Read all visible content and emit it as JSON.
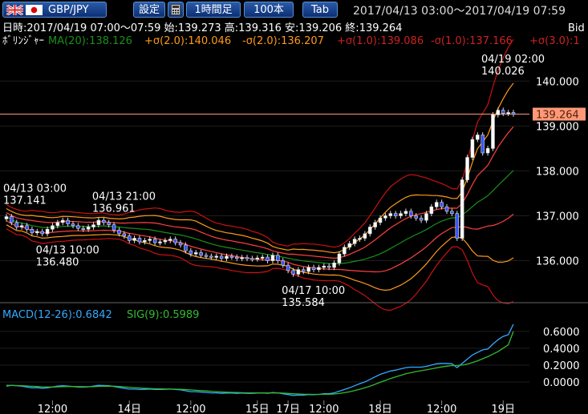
{
  "toolbar": {
    "pair": "GBP/JPY",
    "settings": "設定",
    "interval": "1時間足",
    "bars": "100本",
    "tab": "Tab",
    "range": "2017/04/13 03:00～2017/04/19 07:59"
  },
  "info": {
    "ohlc": "日時:2017/04/19 07:00～07:59 始:139.273 高:139.316 安:139.206 終:139.264",
    "bid": "Bid",
    "boll_label": "ﾎﾞﾘﾝｼﾞｬｰ",
    "ma": "MA(20):138.126",
    "p2": "+σ(2.0):140.046",
    "m2": "-σ(2.0):136.207",
    "p1": "+σ(1.0):139.086",
    "m1": "-σ(1.0):137.166",
    "p3": "+σ(3.0):1"
  },
  "macd_info": {
    "macd": "MACD(12-26):0.6842",
    "sig": "SIG(9):0.5989"
  },
  "colors": {
    "up": "#ffffff",
    "down": "#3355ff",
    "ma": "#1a8f1a",
    "s1": "#ff4040",
    "s2": "#ff9a1a",
    "s3": "#cc1111",
    "macd": "#33aaff",
    "sig": "#33bb33",
    "current": "#ff9977"
  },
  "chart_data": [
    {
      "type": "candlestick",
      "ylim": [
        135.1,
        140.7
      ],
      "yticks": [
        "140.000",
        "139.000",
        "138.000",
        "137.000",
        "136.000"
      ],
      "ytick_values": [
        140,
        139,
        138,
        137,
        136
      ],
      "current_price": "139.264",
      "current_value": 139.264,
      "annotations": [
        {
          "label": "04/13 03:00",
          "value": "137.141",
          "bar": 0,
          "price": 137.141
        },
        {
          "label": "04/13 10:00",
          "value": "136.480",
          "bar": 7,
          "price": 136.48
        },
        {
          "label": "04/13 21:00",
          "value": "136.961",
          "bar": 18,
          "price": 136.961
        },
        {
          "label": "04/17 10:00",
          "value": "135.584",
          "bar": 55,
          "price": 135.584
        },
        {
          "label": "04/19 02:00",
          "value": "140.026",
          "bar": 95,
          "price": 140.026
        }
      ],
      "closes": [
        136.98,
        136.85,
        136.75,
        136.78,
        136.7,
        136.62,
        136.65,
        136.6,
        136.7,
        136.78,
        136.85,
        136.9,
        136.82,
        136.78,
        136.72,
        136.7,
        136.75,
        136.8,
        136.9,
        136.85,
        136.8,
        136.68,
        136.6,
        136.55,
        136.45,
        136.5,
        136.42,
        136.45,
        136.48,
        136.4,
        136.42,
        136.45,
        136.48,
        136.4,
        136.35,
        136.22,
        136.15,
        136.18,
        136.12,
        136.1,
        136.08,
        136.1,
        136.05,
        136.1,
        136.08,
        136.05,
        136.07,
        136.05,
        136.04,
        136.06,
        136.08,
        136.0,
        136.12,
        136.0,
        135.9,
        135.78,
        135.7,
        135.8,
        135.76,
        135.85,
        135.8,
        135.85,
        135.88,
        135.85,
        135.95,
        136.15,
        136.3,
        136.38,
        136.48,
        136.5,
        136.6,
        136.75,
        136.85,
        136.95,
        137.0,
        137.05,
        137.0,
        137.05,
        137.1,
        137.0,
        136.95,
        136.9,
        137.05,
        137.2,
        137.3,
        137.2,
        137.1,
        137.05,
        136.5,
        137.8,
        138.3,
        138.7,
        138.8,
        138.4,
        138.5,
        139.25,
        139.35,
        139.28,
        139.3,
        139.264
      ]
    },
    {
      "type": "line",
      "ylim": [
        -0.2,
        0.75
      ],
      "yticks": [
        "0.6000",
        "0.4000",
        "0.2000",
        "0.0000"
      ],
      "ytick_values": [
        0.6,
        0.4,
        0.2,
        0
      ],
      "series": [
        {
          "name": "MACD(12-26)",
          "values": [
            -0.05,
            -0.04,
            -0.045,
            -0.05,
            -0.06,
            -0.07,
            -0.068,
            -0.075,
            -0.07,
            -0.06,
            -0.05,
            -0.045,
            -0.05,
            -0.055,
            -0.06,
            -0.062,
            -0.058,
            -0.05,
            -0.04,
            -0.042,
            -0.045,
            -0.055,
            -0.065,
            -0.075,
            -0.085,
            -0.085,
            -0.09,
            -0.088,
            -0.085,
            -0.09,
            -0.09,
            -0.088,
            -0.085,
            -0.09,
            -0.095,
            -0.105,
            -0.115,
            -0.115,
            -0.12,
            -0.125,
            -0.13,
            -0.13,
            -0.135,
            -0.132,
            -0.132,
            -0.135,
            -0.133,
            -0.135,
            -0.135,
            -0.133,
            -0.13,
            -0.135,
            -0.125,
            -0.13,
            -0.14,
            -0.15,
            -0.16,
            -0.155,
            -0.157,
            -0.15,
            -0.152,
            -0.148,
            -0.14,
            -0.14,
            -0.13,
            -0.11,
            -0.09,
            -0.07,
            -0.045,
            -0.02,
            0.0,
            0.03,
            0.06,
            0.09,
            0.11,
            0.13,
            0.14,
            0.155,
            0.17,
            0.175,
            0.175,
            0.175,
            0.185,
            0.2,
            0.215,
            0.22,
            0.22,
            0.215,
            0.17,
            0.22,
            0.27,
            0.32,
            0.35,
            0.38,
            0.39,
            0.45,
            0.5,
            0.54,
            0.56,
            0.6842
          ]
        },
        {
          "name": "SIG(9)",
          "values": [
            -0.04,
            -0.042,
            -0.043,
            -0.045,
            -0.048,
            -0.052,
            -0.055,
            -0.058,
            -0.06,
            -0.06,
            -0.058,
            -0.056,
            -0.055,
            -0.055,
            -0.056,
            -0.057,
            -0.057,
            -0.056,
            -0.053,
            -0.051,
            -0.05,
            -0.051,
            -0.054,
            -0.058,
            -0.063,
            -0.068,
            -0.072,
            -0.076,
            -0.078,
            -0.081,
            -0.083,
            -0.084,
            -0.085,
            -0.086,
            -0.088,
            -0.091,
            -0.095,
            -0.099,
            -0.103,
            -0.107,
            -0.111,
            -0.115,
            -0.119,
            -0.122,
            -0.124,
            -0.126,
            -0.128,
            -0.13,
            -0.131,
            -0.131,
            -0.131,
            -0.132,
            -0.131,
            -0.131,
            -0.133,
            -0.136,
            -0.14,
            -0.143,
            -0.146,
            -0.147,
            -0.148,
            -0.148,
            -0.147,
            -0.146,
            -0.143,
            -0.137,
            -0.128,
            -0.117,
            -0.103,
            -0.087,
            -0.07,
            -0.05,
            -0.028,
            -0.004,
            0.018,
            0.04,
            0.06,
            0.078,
            0.096,
            0.11,
            0.123,
            0.133,
            0.143,
            0.155,
            0.167,
            0.178,
            0.187,
            0.194,
            0.195,
            0.2,
            0.21,
            0.23,
            0.25,
            0.275,
            0.3,
            0.33,
            0.36,
            0.4,
            0.44,
            0.5989
          ]
        }
      ]
    }
  ],
  "x_axis": [
    {
      "label": "12:00",
      "bar": 9
    },
    {
      "label": "14日",
      "bar": 24
    },
    {
      "label": "12:00",
      "bar": 36
    },
    {
      "label": "15日",
      "bar": 49
    },
    {
      "label": "17日",
      "bar": 55
    },
    {
      "label": "12:00",
      "bar": 62
    },
    {
      "label": "18日",
      "bar": 73
    },
    {
      "label": "12:00",
      "bar": 85
    },
    {
      "label": "19日",
      "bar": 97
    }
  ]
}
